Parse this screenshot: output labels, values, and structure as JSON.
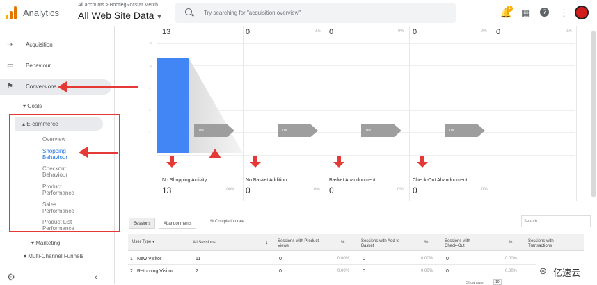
{
  "header": {
    "app_name": "Analytics",
    "breadcrumb": "All accounts > BootlegRocstar Merch",
    "property": "All Web Site Data",
    "search_placeholder": "Try searching for \"acquisition overview\"",
    "notification_count": "1"
  },
  "sidebar": {
    "items": [
      {
        "label": "Acquisition",
        "icon": "acquisition-icon"
      },
      {
        "label": "Behaviour",
        "icon": "behaviour-icon"
      },
      {
        "label": "Conversions",
        "icon": "flag-icon"
      }
    ],
    "goals": "Goals",
    "ecommerce": "E-commerce",
    "ecommerce_links": [
      "Overview",
      "Shopping Behaviour",
      "Checkout Behaviour",
      "Product Performance",
      "Sales Performance",
      "Product List Performance"
    ],
    "marketing": "Marketing",
    "multichannel": "Multi-Channel Funnels"
  },
  "chart_data": {
    "type": "bar",
    "title": "",
    "categories": [
      "All Sessions",
      "Sessions with Product Views",
      "Sessions with Add to Basket",
      "Sessions with Check-Out",
      "Sessions with Transactions"
    ],
    "values": [
      13,
      0,
      0,
      0,
      0
    ],
    "top_percentages": [
      "",
      "0%",
      "0%",
      "0%",
      "0%"
    ],
    "drop_tags": [
      "0%",
      "0%",
      "0%",
      "0%"
    ],
    "y_ticks": [
      "15",
      "12",
      "9",
      "6",
      "3"
    ],
    "ylim": [
      0,
      15
    ]
  },
  "abandonment": [
    {
      "label": "No Shopping Activity",
      "value": "13",
      "pct": "100%"
    },
    {
      "label": "No Basket Addition",
      "value": "0",
      "pct": "0%"
    },
    {
      "label": "Basket Abandonment",
      "value": "0",
      "pct": "0%"
    },
    {
      "label": "Check-Out Abandonment",
      "value": "0",
      "pct": "0%"
    }
  ],
  "table": {
    "tabs": [
      "Sessions",
      "Abandonments"
    ],
    "completion_label": "% Completion rate",
    "search_placeholder": "Search",
    "user_type_header": "User Type",
    "columns": [
      "All Sessions",
      "Sessions with Product Views",
      "%",
      "Sessions with Add to Basket",
      "%",
      "Sessions with Check-Out",
      "%",
      "Sessions with Transactions"
    ],
    "rows": [
      {
        "num": "1",
        "label": "New Visitor",
        "values": [
          "11",
          "0",
          "0.00%",
          "0",
          "0.00%",
          "0",
          "0.00%"
        ]
      },
      {
        "num": "2",
        "label": "Returning Visitor",
        "values": [
          "2",
          "0",
          "0.00%",
          "0",
          "0.00%",
          "0",
          "0.00%"
        ]
      }
    ],
    "footer_label": "Show rows:",
    "footer_value": "10"
  },
  "watermark": {
    "text": "亿速云",
    "logo": "⊛"
  }
}
